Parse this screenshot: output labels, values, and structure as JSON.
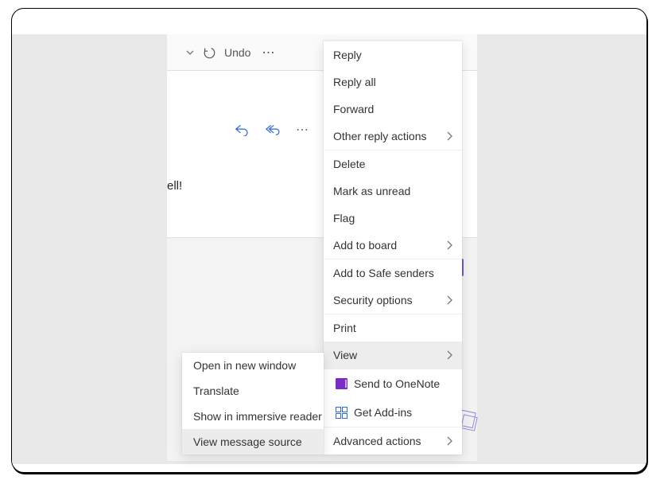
{
  "toolbar": {
    "undo_label": "Undo"
  },
  "message": {
    "snippet": "ell!"
  },
  "menu": {
    "reply": "Reply",
    "reply_all": "Reply all",
    "forward": "Forward",
    "other_reply": "Other reply actions",
    "delete": "Delete",
    "mark_unread": "Mark as unread",
    "flag": "Flag",
    "add_to_board": "Add to board",
    "safe_senders": "Add to Safe senders",
    "security_options": "Security options",
    "print": "Print",
    "view": "View",
    "send_onenote": "Send to OneNote",
    "get_addins": "Get Add-ins",
    "advanced_actions": "Advanced actions"
  },
  "submenu": {
    "open_new_window": "Open in new window",
    "translate": "Translate",
    "immersive_reader": "Show in immersive reader",
    "view_source": "View message source"
  }
}
